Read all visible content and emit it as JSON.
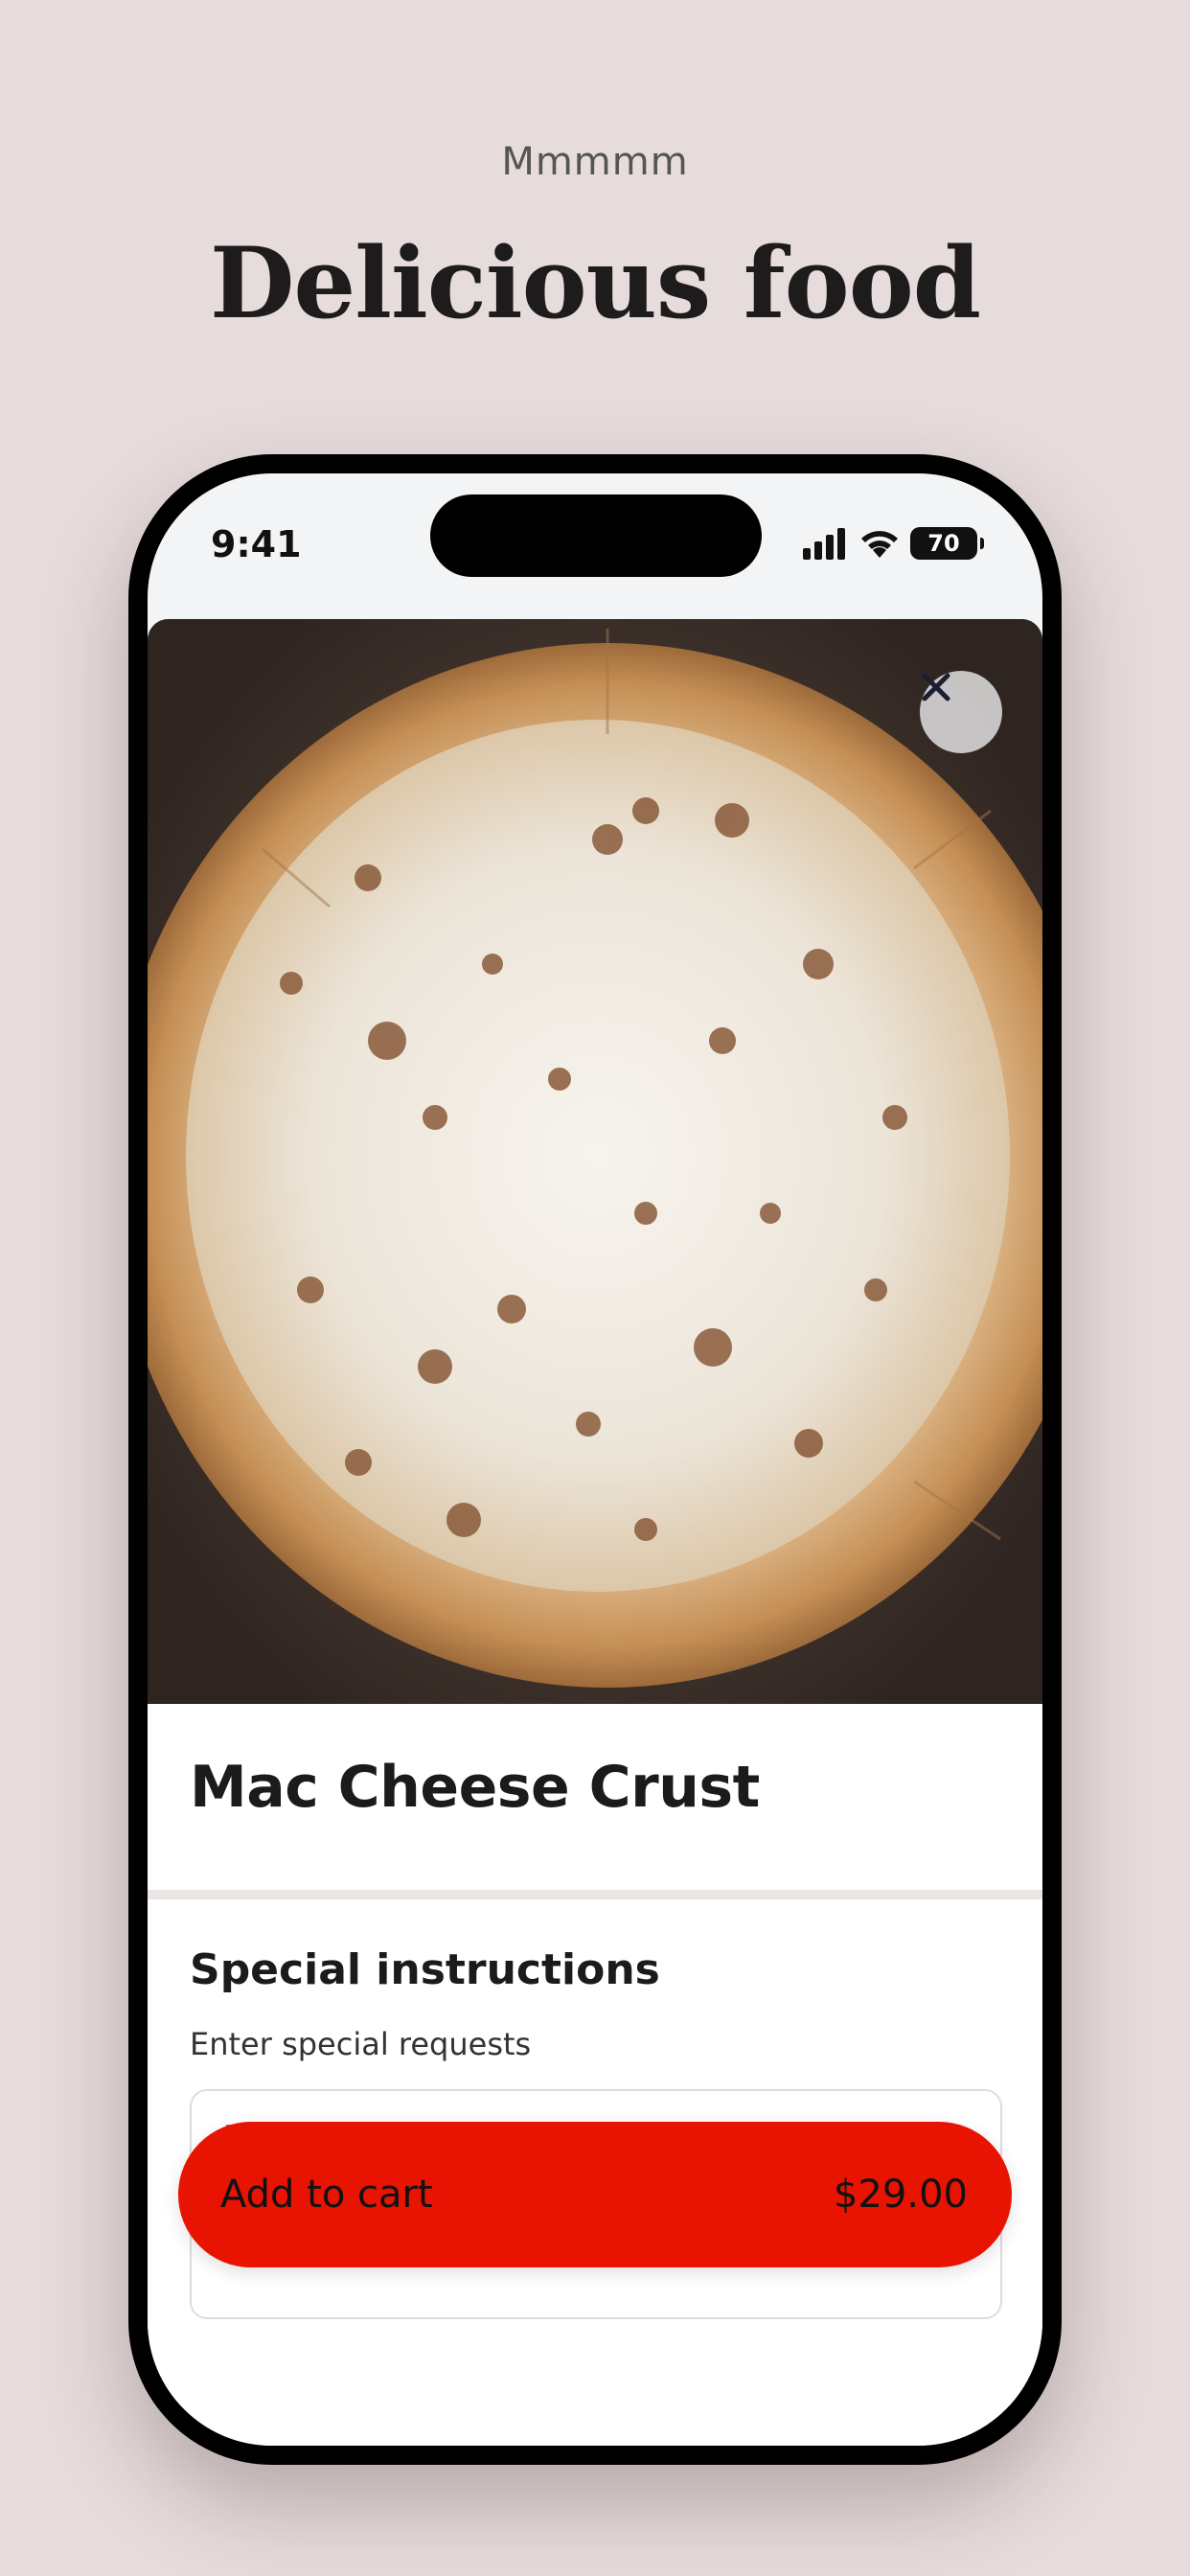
{
  "header": {
    "eyebrow": "Mmmmm",
    "headline": "Delicious food"
  },
  "status_bar": {
    "time": "9:41",
    "battery": "70",
    "icons": [
      "signal-icon",
      "wifi-icon",
      "battery-icon"
    ]
  },
  "product": {
    "image_icon": "pizza-photo",
    "name": "Mac Cheese Crust"
  },
  "instructions": {
    "heading": "Special instructions",
    "subtitle": "Enter special requests",
    "placeholder": "Enter special requests"
  },
  "cart_button": {
    "label": "Add to cart",
    "price": "$29.00"
  },
  "colors": {
    "background": "#e6dcdb",
    "accent": "#e81300",
    "text": "#1b1b1b"
  }
}
